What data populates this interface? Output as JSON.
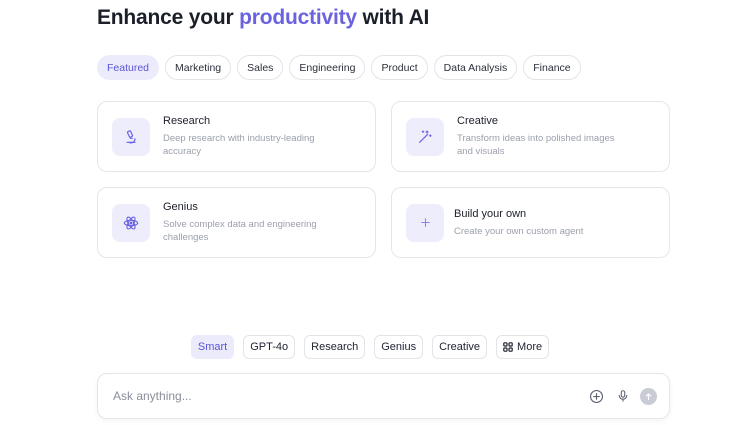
{
  "headline": {
    "prefix": "Enhance your ",
    "accent": "productivity",
    "suffix": " with AI"
  },
  "filters": [
    {
      "label": "Featured",
      "active": true
    },
    {
      "label": "Marketing",
      "active": false
    },
    {
      "label": "Sales",
      "active": false
    },
    {
      "label": "Engineering",
      "active": false
    },
    {
      "label": "Product",
      "active": false
    },
    {
      "label": "Data Analysis",
      "active": false
    },
    {
      "label": "Finance",
      "active": false
    }
  ],
  "agents": [
    {
      "title": "Research",
      "desc": "Deep research with industry-leading accuracy",
      "icon": "microscope-icon"
    },
    {
      "title": "Creative",
      "desc": "Transform ideas into polished images and visuals",
      "icon": "magic-wand-icon"
    },
    {
      "title": "Genius",
      "desc": "Solve complex data and engineering challenges",
      "icon": "atom-icon"
    },
    {
      "title": "Build your own",
      "desc": "Create your own custom agent",
      "icon": "plus-icon"
    }
  ],
  "models": [
    {
      "label": "Smart",
      "active": true
    },
    {
      "label": "GPT-4o",
      "active": false
    },
    {
      "label": "Research",
      "active": false
    },
    {
      "label": "Genius",
      "active": false
    },
    {
      "label": "Creative",
      "active": false
    },
    {
      "label": "More",
      "active": false,
      "icon": "grid-icon"
    }
  ],
  "composer": {
    "placeholder": "Ask anything...",
    "icons": [
      "add-circle-icon",
      "microphone-icon",
      "send-arrow-icon"
    ]
  },
  "colors": {
    "accent": "#6a63e0",
    "chip_active_bg": "#ecebfc",
    "icon_tile_bg": "#eeedfc",
    "border": "#e4e6ec",
    "muted_text": "#9ba0ac"
  }
}
